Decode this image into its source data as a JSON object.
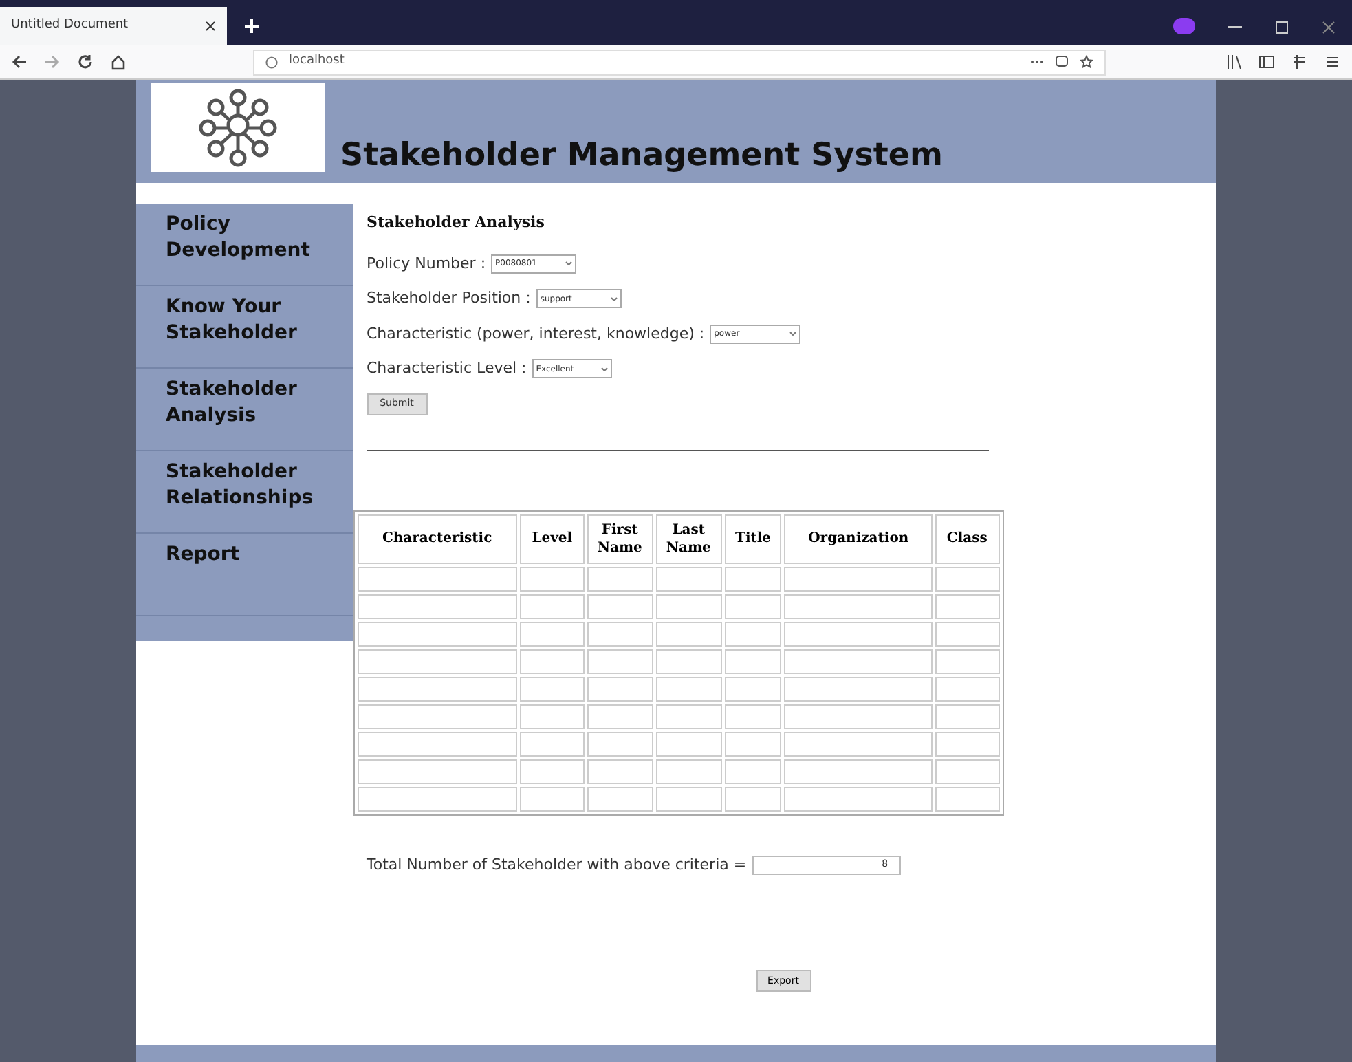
{
  "browser": {
    "tab_title": "Untitled Document",
    "url": "localhost"
  },
  "header": {
    "title": "Stakeholder Management System"
  },
  "sidebar": {
    "items": [
      {
        "label": "Policy Development"
      },
      {
        "label": "Know Your Stakeholder"
      },
      {
        "label": "Stakeholder Analysis"
      },
      {
        "label": "Stakeholder Relationships"
      },
      {
        "label": "Report"
      }
    ]
  },
  "form": {
    "heading": "Stakeholder Analysis",
    "fields": [
      {
        "label": "Policy Number :",
        "value": "P0080801"
      },
      {
        "label": "Stakeholder Position :",
        "value": "support"
      },
      {
        "label": "Characteristic (power, interest, knowledge) :",
        "value": "power"
      },
      {
        "label": "Characteristic Level :",
        "value": "Excellent"
      }
    ],
    "submit": "Submit"
  },
  "table": {
    "columns": [
      "Characteristic",
      "Level",
      "First Name",
      "Last Name",
      "Title",
      "Organization",
      "Class"
    ]
  },
  "total": {
    "label": "Total Number of Stakeholder with above criteria =",
    "value": "8"
  },
  "export": "Export"
}
